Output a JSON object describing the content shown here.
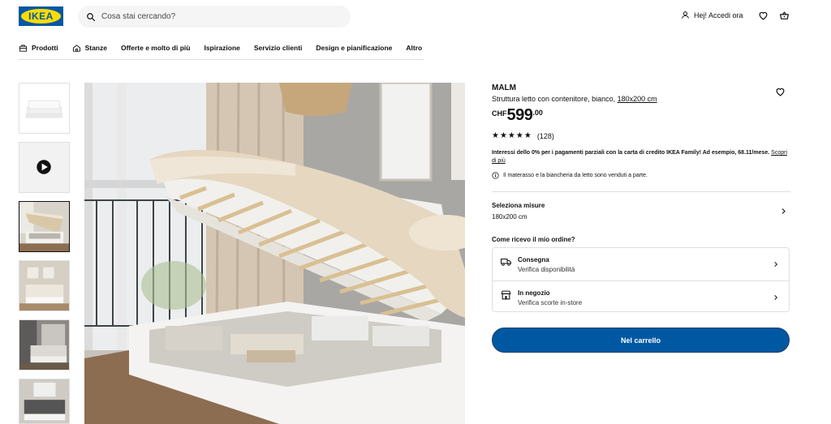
{
  "header": {
    "logo_text": "IKEA",
    "search_placeholder": "Cosa stai cercando?",
    "account_label": "Hej! Accedi ora",
    "icons": [
      "search-icon",
      "user-icon",
      "heart-icon",
      "cart-icon"
    ]
  },
  "nav": {
    "items": [
      {
        "label": "Prodotti",
        "icon": "box-icon"
      },
      {
        "label": "Stanze",
        "icon": "home-icon"
      },
      {
        "label": "Offerte e molto di più"
      },
      {
        "label": "Ispirazione"
      },
      {
        "label": "Servizio clienti"
      },
      {
        "label": "Design e pianificazione"
      },
      {
        "label": "Altro"
      }
    ]
  },
  "gallery": {
    "thumbnail_count": 6,
    "selected_index": 2,
    "video_thumbnail_index": 1
  },
  "product": {
    "name": "MALM",
    "description": "Struttura letto con contenitore, bianco,",
    "size_link": "180x200 cm",
    "price_currency": "CHF",
    "price_integer": "599",
    "price_decimal": ".00",
    "rating": 4.5,
    "rating_stars": "★★★★★",
    "review_count": "(128)",
    "finance_text": "Interessi dello 0% per i pagamenti parziali con la carta di credito IKEA Family! Ad esempio, 68.11/mese.",
    "finance_link": "Scopri di più",
    "notice": "Il materasso e la biancheria da letto sono venduti a parte."
  },
  "size_selector": {
    "title": "Seleziona misure",
    "value": "180x200 cm"
  },
  "order": {
    "title": "Come ricevo il mio ordine?",
    "options": [
      {
        "title": "Consegna",
        "subtitle": "Verifica disponibilità",
        "icon": "truck-icon"
      },
      {
        "title": "In negozio",
        "subtitle": "Verifica scorte in-store",
        "icon": "store-icon"
      }
    ]
  },
  "cart_button_label": "Nel carrello",
  "colors": {
    "brand_blue": "#0058a3",
    "brand_yellow": "#ffdb00",
    "border": "#dfdfdf"
  }
}
